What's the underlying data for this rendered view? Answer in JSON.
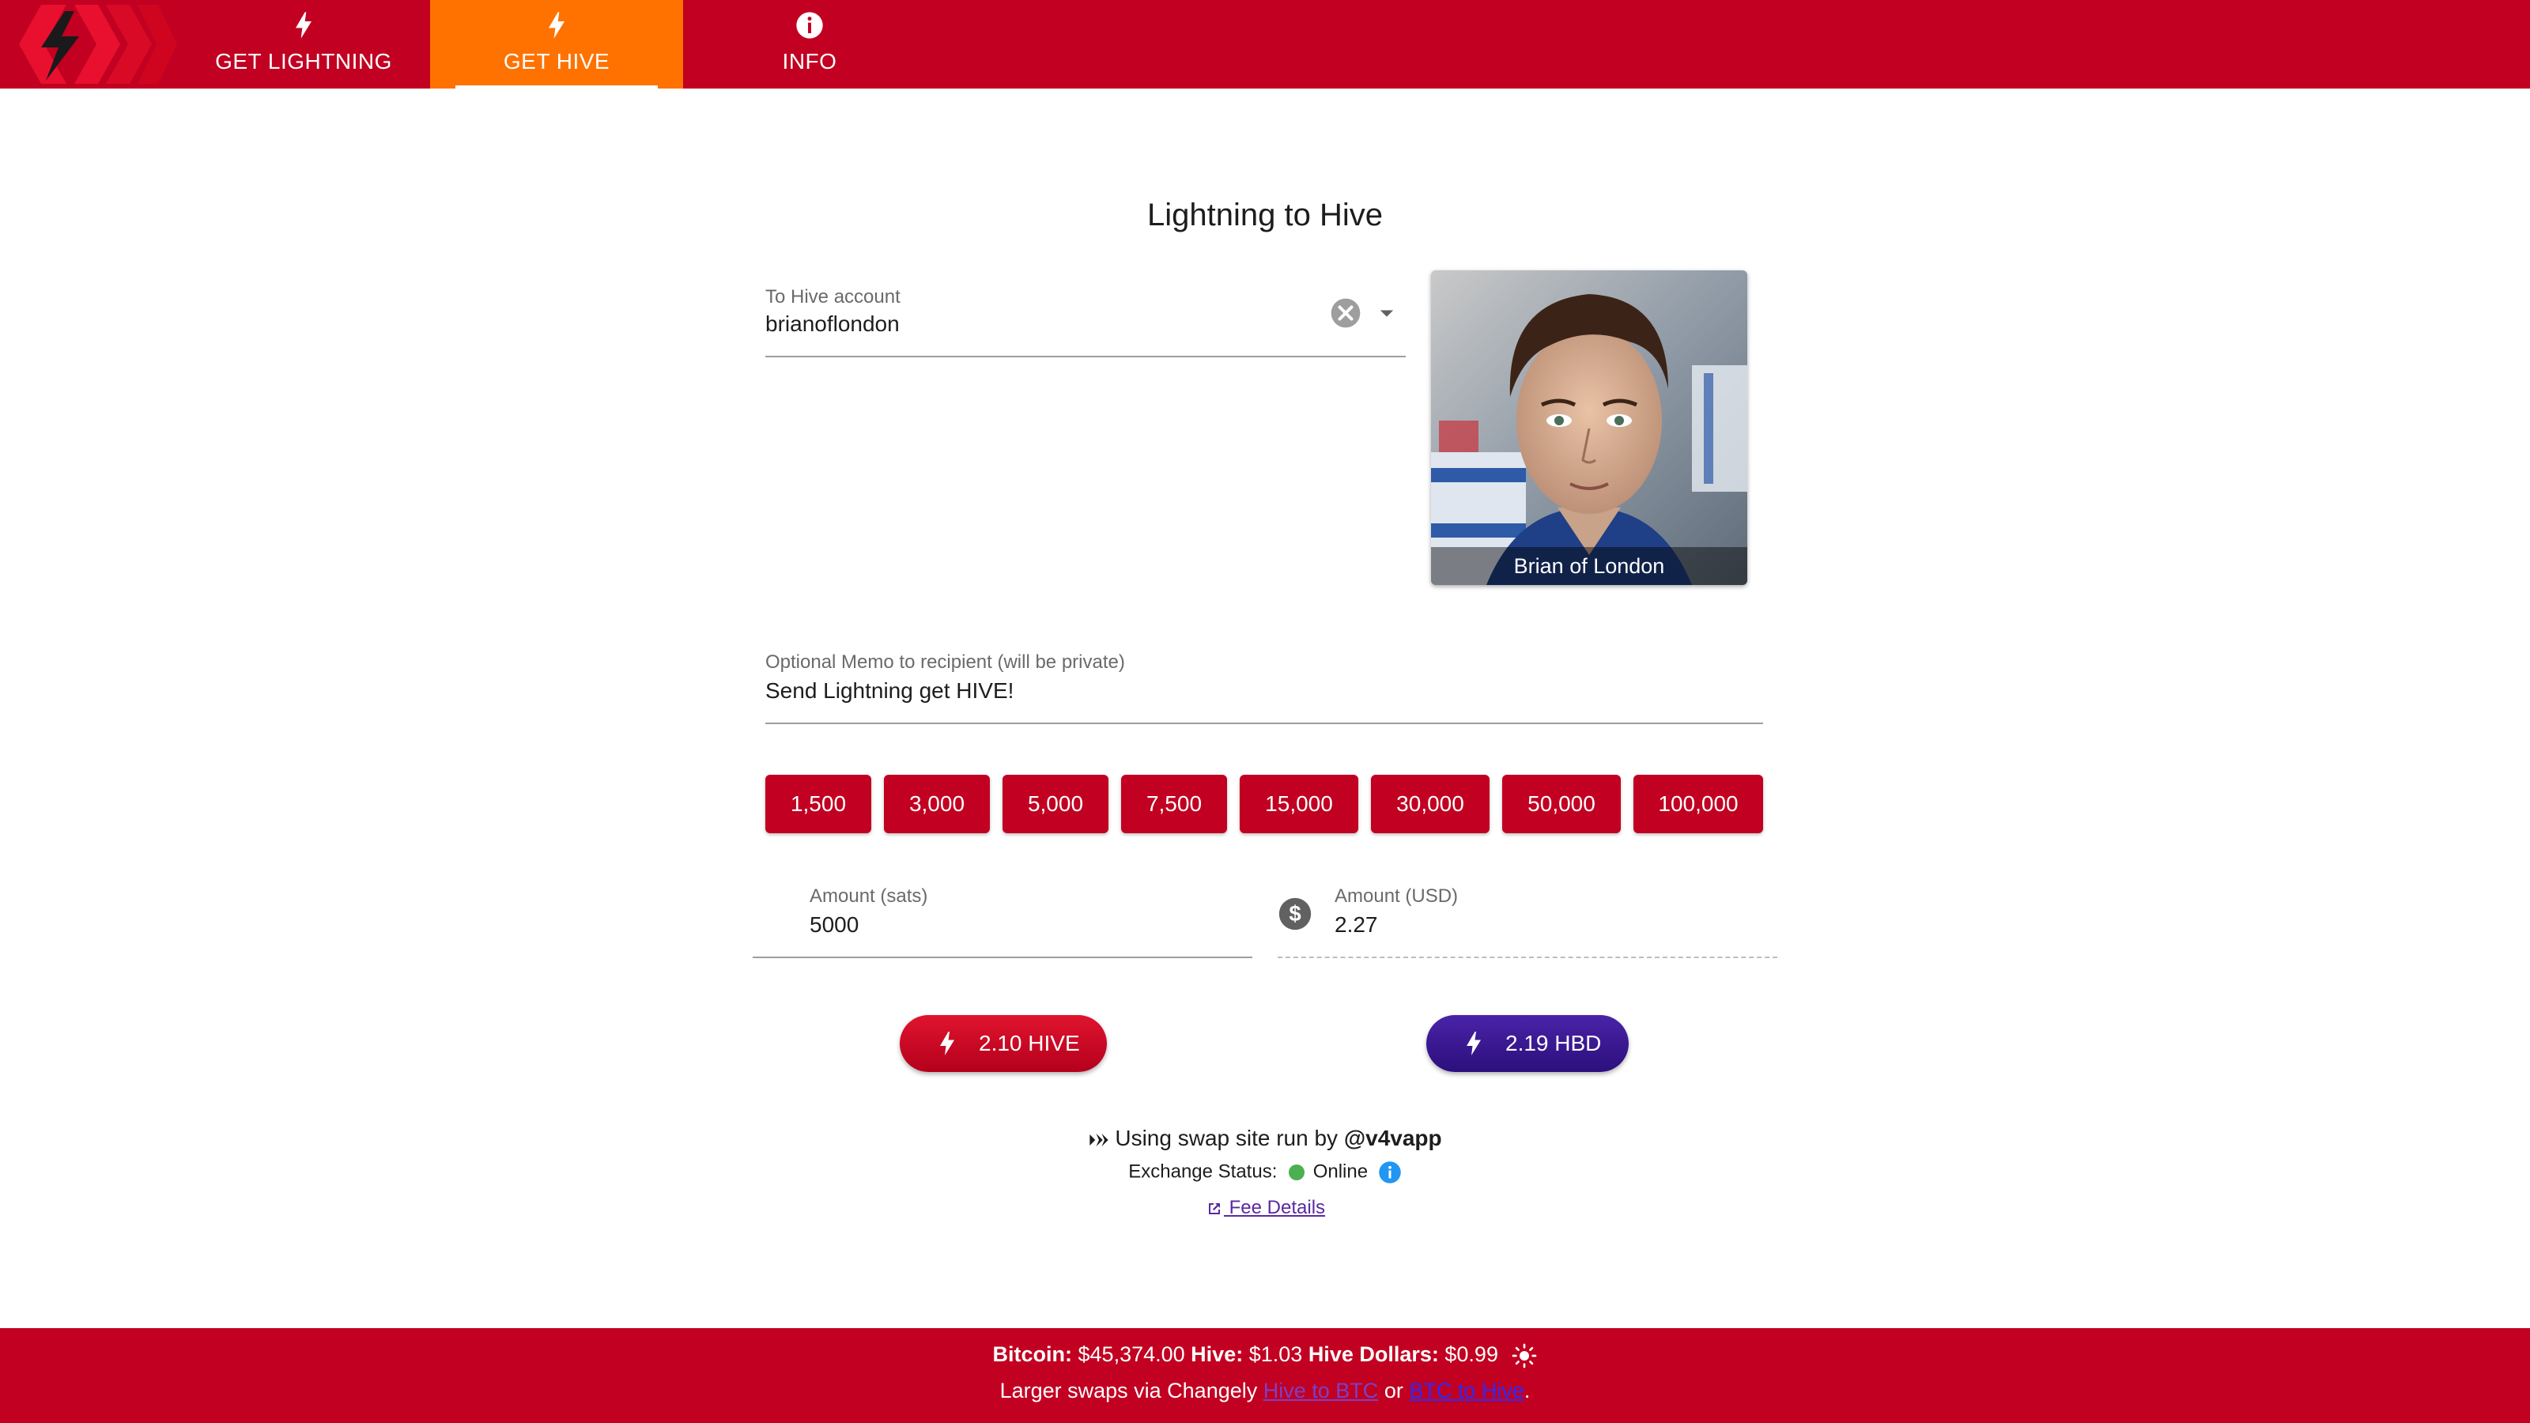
{
  "colors": {
    "brand_red": "#c20021",
    "active_tab": "#ff7200",
    "hbd_purple": "#2c0f7c",
    "status_online": "#4caf50",
    "info_blue": "#2196f3"
  },
  "nav": {
    "logo_icon": "hive-lightning-logo-icon",
    "tabs": [
      {
        "label": "GET LIGHTNING",
        "icon": "lightning-bolt-icon",
        "active": false
      },
      {
        "label": "GET HIVE",
        "icon": "lightning-bolt-icon",
        "active": true
      },
      {
        "label": "INFO",
        "icon": "info-circle-icon",
        "active": false
      }
    ]
  },
  "main": {
    "title": "Lightning to Hive",
    "account": {
      "label": "To Hive account",
      "value": "brianoflondon"
    },
    "avatar": {
      "caption": "Brian of London"
    },
    "memo": {
      "label": "Optional Memo to recipient (will be private)",
      "value": "Send Lightning get HIVE!"
    },
    "preset_amounts": [
      "1,500",
      "3,000",
      "5,000",
      "7,500",
      "15,000",
      "30,000",
      "50,000",
      "100,000"
    ],
    "amount_sats": {
      "label": "Amount (sats)",
      "value": "5000"
    },
    "amount_usd": {
      "label": "Amount (USD)",
      "value": "2.27",
      "icon": "dollar-circle-icon"
    },
    "buttons": {
      "hive": "2.10 HIVE",
      "hbd": "2.19 HBD"
    },
    "info": {
      "swap_prefix": "Using swap site run by ",
      "swap_operator": "@v4vapp",
      "status_label": "Exchange Status:",
      "status_value": "Online",
      "fee_link": " Fee Details"
    }
  },
  "footer": {
    "btc_label": "Bitcoin:",
    "btc_value": "$45,374.00",
    "hive_label": "Hive:",
    "hive_value": "$1.03",
    "hbd_label": "Hive Dollars:",
    "hbd_value": "$0.99",
    "theme_icon": "sun-icon",
    "swaps_text": "Larger swaps via Changely",
    "link_hive_btc": "Hive to BTC",
    "or_text": "or",
    "link_btc_hive": "BTC to Hive",
    "period": "."
  }
}
